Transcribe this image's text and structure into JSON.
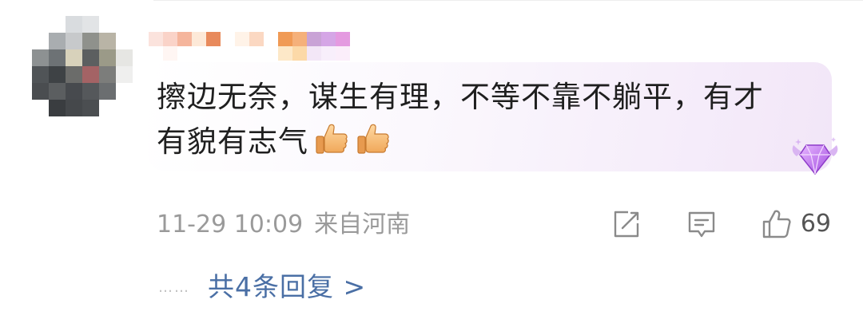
{
  "comment": {
    "text": "擦边无奈，谋生有理，不等不靠不躺平，有才\n有貌有志气",
    "emoji": [
      "thumbs-up-icon",
      "thumbs-up-icon"
    ],
    "timestamp": "11-29 10:09",
    "location": "来自河南",
    "like_count": "69",
    "replies_dots": "……",
    "replies_label": "共4条回复 >"
  },
  "colors": {
    "link": "#4a6fa5",
    "meta_text": "#9a9a9a",
    "bubble_accent": "#f2e6f8",
    "badge": "#b566e0"
  }
}
